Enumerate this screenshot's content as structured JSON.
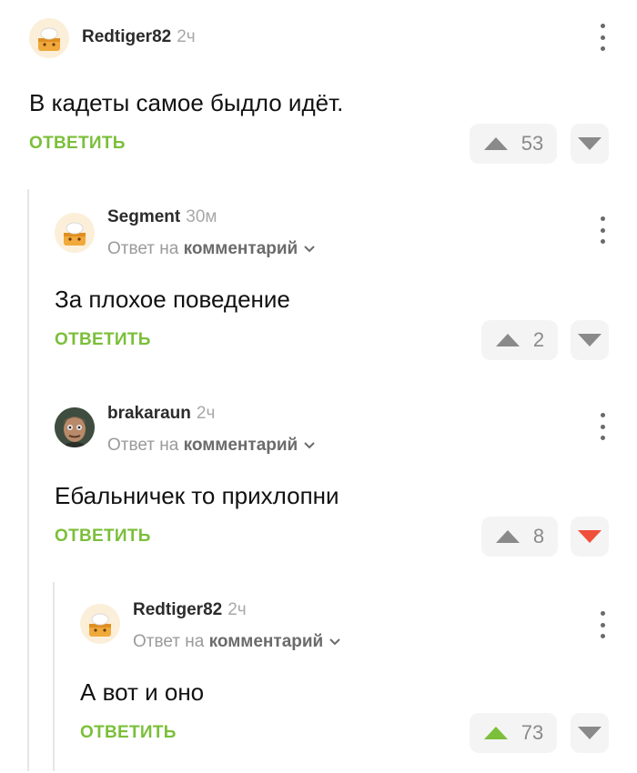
{
  "comments": [
    {
      "username": "Redtiger82",
      "time": "2ч",
      "text": "В кадеты самое быдло идёт.",
      "reply_label": "ОТВЕТИТЬ",
      "votes": "53",
      "vote_state": "none"
    },
    {
      "username": "Segment",
      "time": "30м",
      "reply_to_prefix": "Ответ на",
      "reply_to_target": "комментарий",
      "text": "За плохое поведение",
      "reply_label": "ОТВЕТИТЬ",
      "votes": "2",
      "vote_state": "none"
    },
    {
      "username": "brakaraun",
      "time": "2ч",
      "reply_to_prefix": "Ответ на",
      "reply_to_target": "комментарий",
      "text": "Ебальничек то прихлопни",
      "reply_label": "ОТВЕТИТЬ",
      "votes": "8",
      "vote_state": "down"
    },
    {
      "username": "Redtiger82",
      "time": "2ч",
      "reply_to_prefix": "Ответ на",
      "reply_to_target": "комментарий",
      "text": "А вот и оно",
      "reply_label": "ОТВЕТИТЬ",
      "votes": "73",
      "vote_state": "up"
    }
  ],
  "colors": {
    "accent_green": "#7bbf3a",
    "downvote_red": "#ef4f3b",
    "neutral_arrow": "#8a8a8a",
    "chip_bg": "#f4f4f4"
  }
}
